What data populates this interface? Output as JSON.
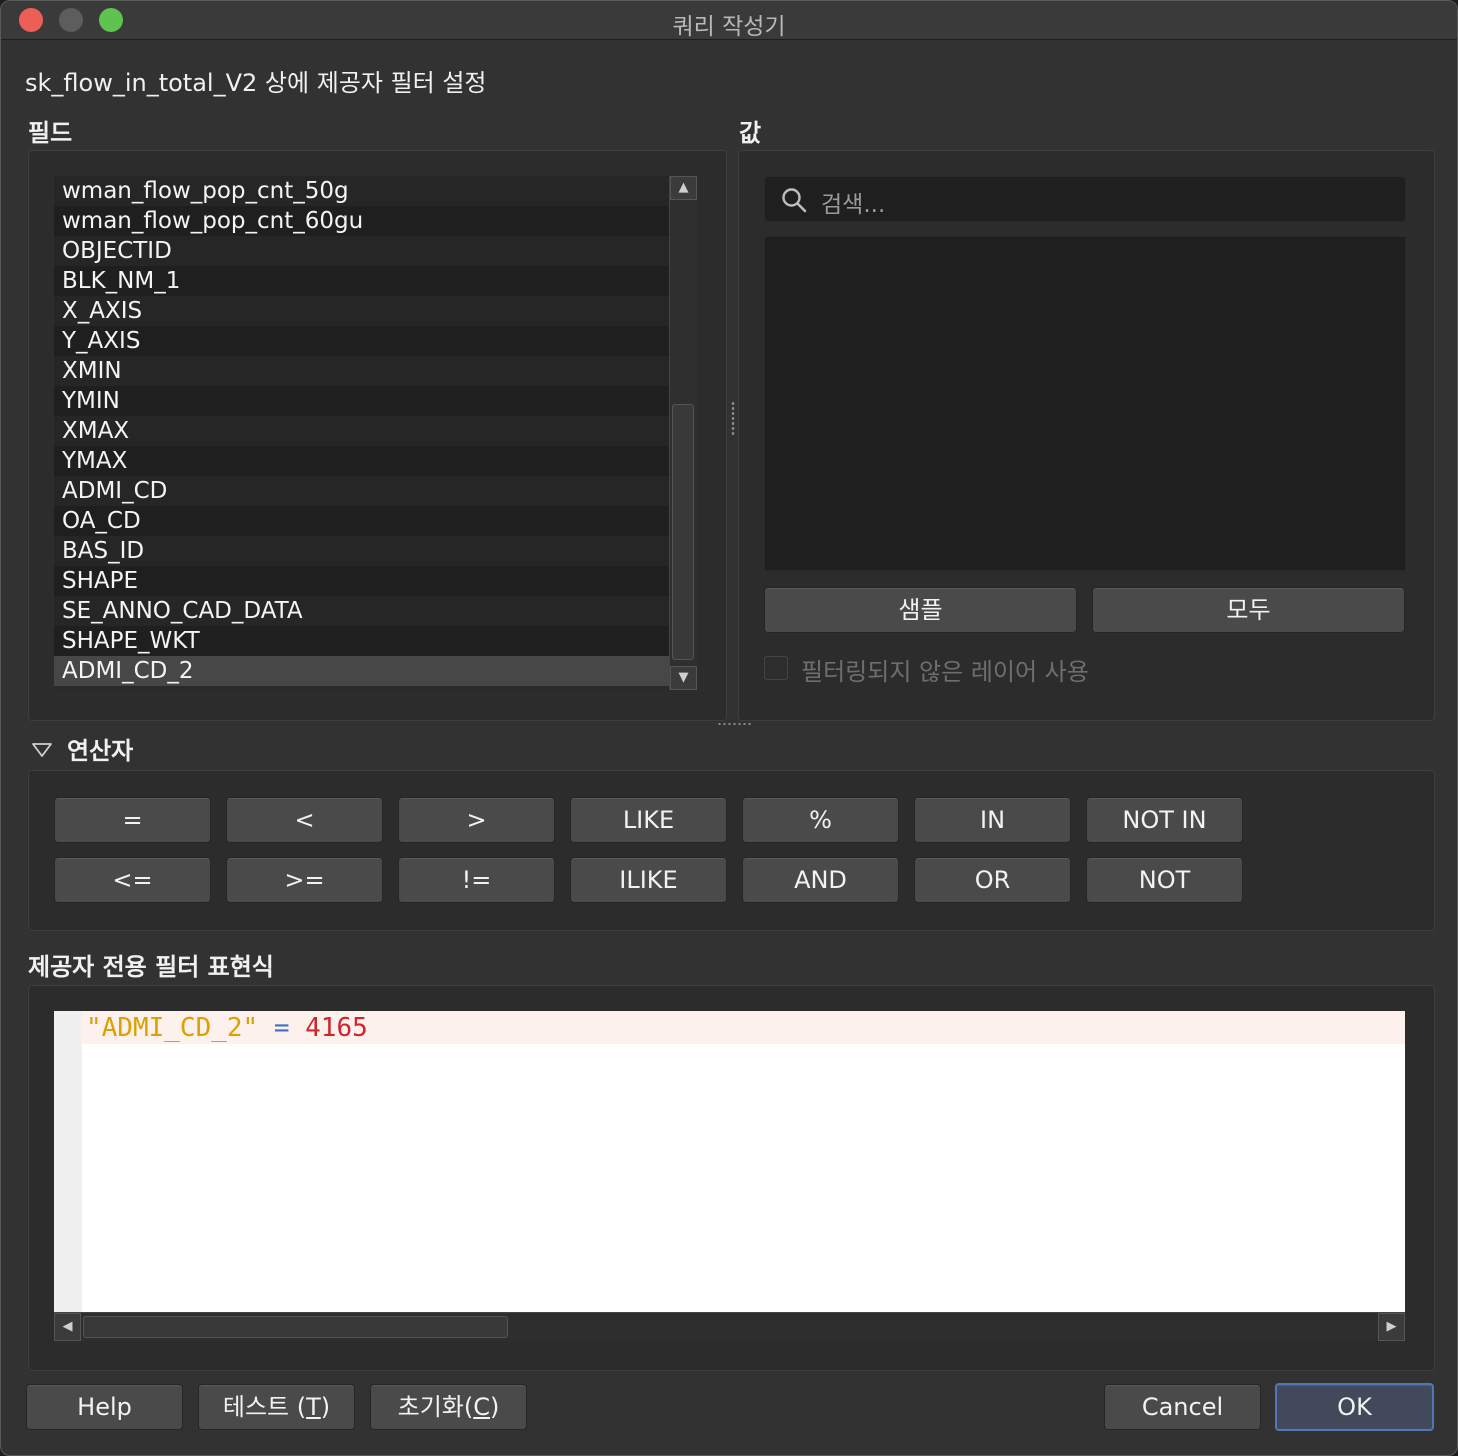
{
  "window": {
    "title": "쿼리 작성기"
  },
  "heading": "sk_flow_in_total_V2 상에 제공자 필터 설정",
  "fields": {
    "label": "필드",
    "items": [
      "wman_flow_pop_cnt_50g",
      "wman_flow_pop_cnt_60gu",
      "OBJECTID",
      "BLK_NM_1",
      "X_AXIS",
      "Y_AXIS",
      "XMIN",
      "YMIN",
      "XMAX",
      "YMAX",
      "ADMI_CD",
      "OA_CD",
      "BAS_ID",
      "SHAPE",
      "SE_ANNO_CAD_DATA",
      "SHAPE_WKT",
      "ADMI_CD_2"
    ],
    "selected": "ADMI_CD_2"
  },
  "values": {
    "label": "값",
    "search_placeholder": "검색...",
    "sample_button": "샘플",
    "all_button": "모두",
    "checkbox_label": "필터링되지 않은 레이어 사용",
    "checkbox_checked": false
  },
  "operators": {
    "label": "연산자",
    "row1": [
      "=",
      "<",
      ">",
      "LIKE",
      "%",
      "IN",
      "NOT IN"
    ],
    "row2": [
      "<=",
      ">=",
      "!=",
      "ILIKE",
      "AND",
      "OR",
      "NOT"
    ]
  },
  "expression": {
    "label": "제공자 전용 필터 표현식",
    "field_token": "\"ADMI_CD_2\"",
    "operator_token": "=",
    "value_token": "4165"
  },
  "buttons": {
    "help": "Help",
    "test_prefix": "테스트 (",
    "test_key": "T",
    "reset_prefix": "초기화(",
    "reset_key": "C",
    "close_paren": ")",
    "cancel": "Cancel",
    "ok": "OK"
  },
  "colors": {
    "string_token": "#dca100",
    "operator_token": "#3b6fc6",
    "number_token": "#d0252b",
    "ok_border": "#5277b9"
  },
  "icons": {
    "search": "search-icon",
    "collapse": "triangle-down-icon",
    "scroll_up": "arrow-up-icon",
    "scroll_down": "arrow-down-icon",
    "scroll_left": "arrow-left-icon",
    "scroll_right": "arrow-right-icon"
  }
}
